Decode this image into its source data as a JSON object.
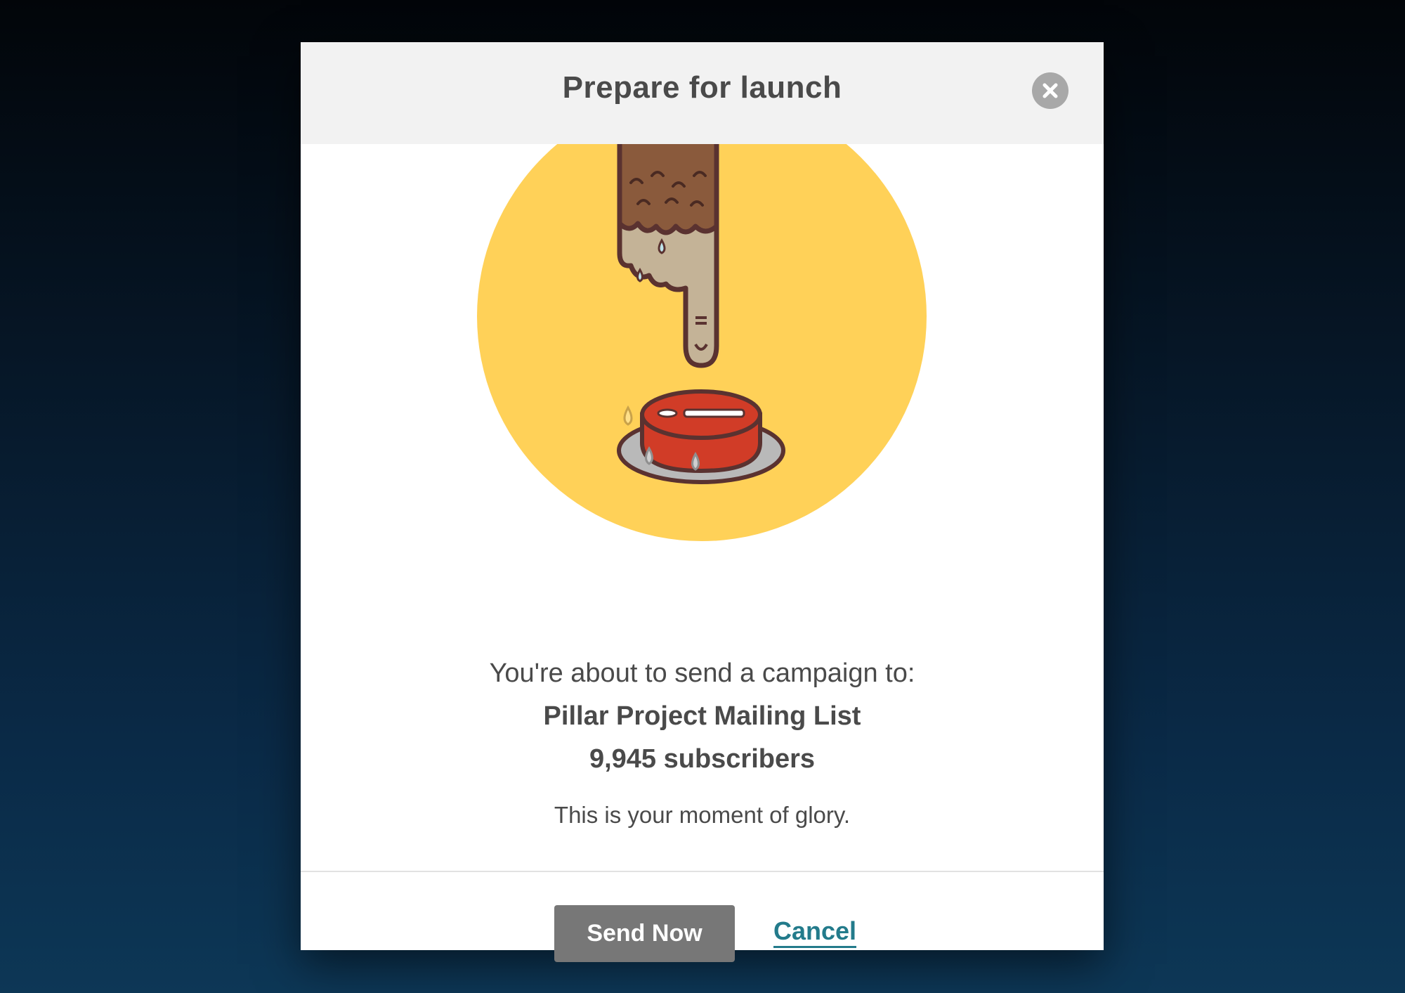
{
  "modal": {
    "title": "Prepare for launch",
    "close_icon": "close-x-icon"
  },
  "illustration": {
    "description_icon": "finger-pressing-red-button-icon",
    "circle_color": "#ffd158",
    "button_color": "#d13c27"
  },
  "message": {
    "lead": "You're about to send a campaign to:",
    "list_name": "Pillar Project Mailing List",
    "subscribers": "9,945 subscribers",
    "tagline": "This is your moment of glory."
  },
  "actions": {
    "send_label": "Send Now",
    "cancel_label": "Cancel"
  },
  "colors": {
    "send_button": "#777777",
    "cancel_link": "#237b8b"
  }
}
